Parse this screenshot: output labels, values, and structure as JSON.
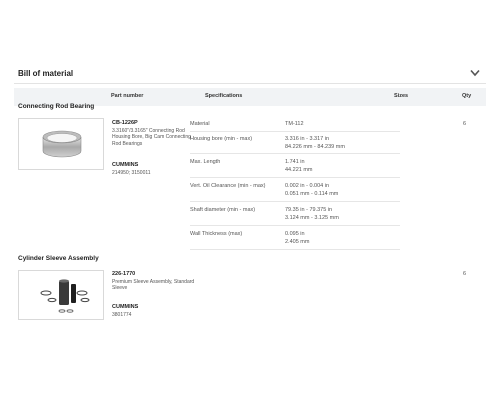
{
  "bom": {
    "title": "Bill of material",
    "chevron_icon": "chevron-down-icon",
    "columns": {
      "part_number": "Part number",
      "specifications": "Specifications",
      "sizes": "Sizes",
      "qty": "Qty"
    },
    "sections": [
      {
        "title": "Connecting Rod Bearing",
        "part_number": "CB-1226P",
        "description_lines": [
          "3.3160\"/3.3165\" Connecting Rod",
          "Housing Bore, Big Cam Connecting",
          "Rod Bearings"
        ],
        "brand": "CUMMINS",
        "brand_numbers": "214950; 3150011",
        "qty": "6",
        "specs": [
          {
            "label": "Material",
            "values": [
              "TM-112"
            ]
          },
          {
            "label": "Housing bore (min - max)",
            "values": [
              "3.316 in - 3.317 in",
              "84.226 mm - 84.239 mm"
            ]
          },
          {
            "label": "Max. Length",
            "values": [
              "1.741 in",
              "44.221 mm"
            ]
          },
          {
            "label": "Vert. Oil Clearance (min - max)",
            "values": [
              "0.002 in - 0.004 in",
              "0.051 mm - 0.114 mm"
            ]
          },
          {
            "label": "Shaft diameter (min - max)",
            "values": [
              "79.35 in - 79.375 in",
              "3.124 mm - 3.125 mm"
            ]
          },
          {
            "label": "Wall Thickness (max)",
            "values": [
              "0.095 in",
              "2.405 mm"
            ]
          }
        ]
      },
      {
        "title": "Cylinder Sleeve Assembly",
        "part_number": "226-1770",
        "description_lines": [
          "Premium Sleeve Assembly, Standard",
          "Sleeve"
        ],
        "brand": "CUMMINS",
        "brand_numbers": "3801774",
        "qty": "6"
      }
    ]
  }
}
